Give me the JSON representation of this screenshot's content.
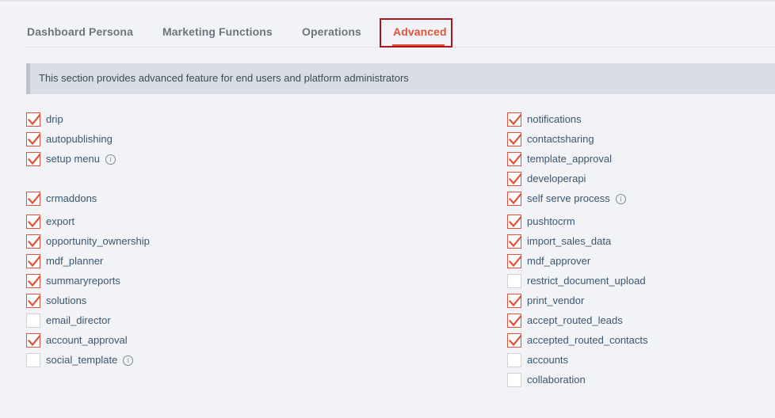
{
  "tabs": [
    {
      "label": "Dashboard Persona",
      "active": false
    },
    {
      "label": "Marketing Functions",
      "active": false
    },
    {
      "label": "Operations",
      "active": false
    },
    {
      "label": "Advanced",
      "active": true
    }
  ],
  "banner": {
    "text": "This section provides advanced feature for end users and platform administrators"
  },
  "info_icon_glyph": "i",
  "colors": {
    "accent": "#e0533b",
    "focus_outline": "#b0131b",
    "label": "#3b5670"
  },
  "options_left": [
    {
      "label": "drip",
      "checked": true,
      "info": false
    },
    {
      "label": "autopublishing",
      "checked": true,
      "info": false
    },
    {
      "label": "setup menu",
      "checked": true,
      "info": true
    },
    {
      "label": "crmaddons",
      "checked": true,
      "info": false
    },
    {
      "label": "export",
      "checked": true,
      "info": false
    },
    {
      "label": "opportunity_ownership",
      "checked": true,
      "info": false
    },
    {
      "label": "mdf_planner",
      "checked": true,
      "info": false
    },
    {
      "label": "summaryreports",
      "checked": true,
      "info": false
    },
    {
      "label": "solutions",
      "checked": true,
      "info": false
    },
    {
      "label": "email_director",
      "checked": false,
      "info": false
    },
    {
      "label": "account_approval",
      "checked": true,
      "info": false
    },
    {
      "label": "social_template",
      "checked": false,
      "info": true
    }
  ],
  "options_right": [
    {
      "label": "notifications",
      "checked": true,
      "info": false
    },
    {
      "label": "contactsharing",
      "checked": true,
      "info": false
    },
    {
      "label": "template_approval",
      "checked": true,
      "info": false
    },
    {
      "label": "developerapi",
      "checked": true,
      "info": false
    },
    {
      "label": "self serve process",
      "checked": true,
      "info": true
    },
    {
      "label": "pushtocrm",
      "checked": true,
      "info": false
    },
    {
      "label": "import_sales_data",
      "checked": true,
      "info": false
    },
    {
      "label": "mdf_approver",
      "checked": true,
      "info": false
    },
    {
      "label": "restrict_document_upload",
      "checked": false,
      "info": false
    },
    {
      "label": "print_vendor",
      "checked": true,
      "info": false
    },
    {
      "label": "accept_routed_leads",
      "checked": true,
      "info": false
    },
    {
      "label": "accepted_routed_contacts",
      "checked": true,
      "info": false
    },
    {
      "label": "accounts",
      "checked": false,
      "info": false
    },
    {
      "label": "collaboration",
      "checked": false,
      "info": false
    }
  ]
}
